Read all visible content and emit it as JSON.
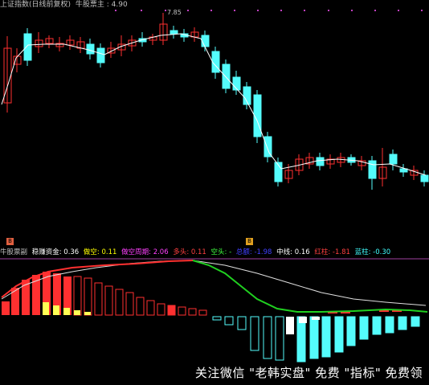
{
  "header": {
    "title": "上证指数(日线前复权)",
    "param_label": "牛股票主 : 4.90"
  },
  "price_panel": {
    "high_label": "7.85"
  },
  "markers": [
    {
      "text": "B",
      "color": "#e06040"
    },
    {
      "text": "B",
      "color": "#e0a020"
    }
  ],
  "indicator_header": {
    "name": "牛股票副",
    "items": [
      {
        "label": "稳赚资金: 0.36",
        "color": "#ffffff"
      },
      {
        "label": "做空: 0.11",
        "color": "#ffff00"
      },
      {
        "label": "做空周期: 2.06",
        "color": "#ff40ff"
      },
      {
        "label": "多头: 0.11",
        "color": "#ff4040"
      },
      {
        "label": "空头: -",
        "color": "#40ff40"
      },
      {
        "label": "总额: -1.98",
        "color": "#4040ff"
      },
      {
        "label": "中线: 0.16",
        "color": "#ffffff"
      },
      {
        "label": "红柱: -1.81",
        "color": "#ff4040"
      },
      {
        "label": "蓝柱: -0.30",
        "color": "#40ffff"
      }
    ]
  },
  "watermark": "关注微信 \"老韩实盘\" 免费 \"指标\" 免费领",
  "colors": {
    "up": "#ff3030",
    "down": "#54fcfc",
    "ma": "#ffffff",
    "yellow": "#ffff54",
    "green": "#20d020",
    "separator": "#a040a0"
  }
}
